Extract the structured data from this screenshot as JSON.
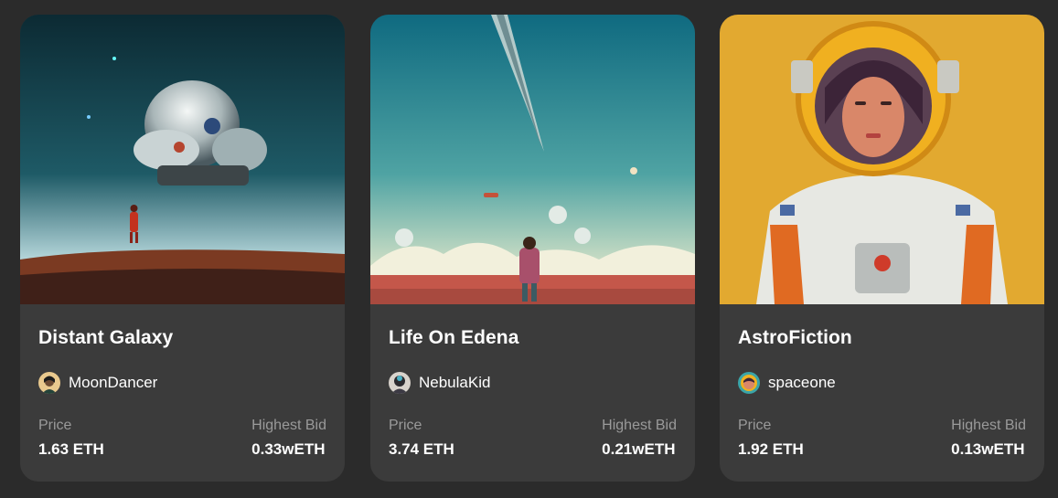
{
  "cards": [
    {
      "title": "Distant Galaxy",
      "artist": "MoonDancer",
      "price_label": "Price",
      "price": "1.63 ETH",
      "bid_label": "Highest Bid",
      "bid": "0.33wETH",
      "image": "astronaut-on-planet-with-giant-spaceship"
    },
    {
      "title": "Life On Edena",
      "artist": "NebulaKid",
      "price_label": "Price",
      "price": "3.74 ETH",
      "bid_label": "Highest Bid",
      "bid": "0.21wETH",
      "image": "figure-walking-on-red-desert-with-domes"
    },
    {
      "title": "AstroFiction",
      "artist": "spaceone",
      "price_label": "Price",
      "price": "1.92 ETH",
      "bid_label": "Highest Bid",
      "bid": "0.13wETH",
      "image": "woman-astronaut-portrait-yellow-background"
    }
  ],
  "colors": {
    "page_background": "#2b2b2b",
    "card_background": "#3b3b3b",
    "label_gray": "#9a9a9a",
    "text_white": "#ffffff"
  }
}
